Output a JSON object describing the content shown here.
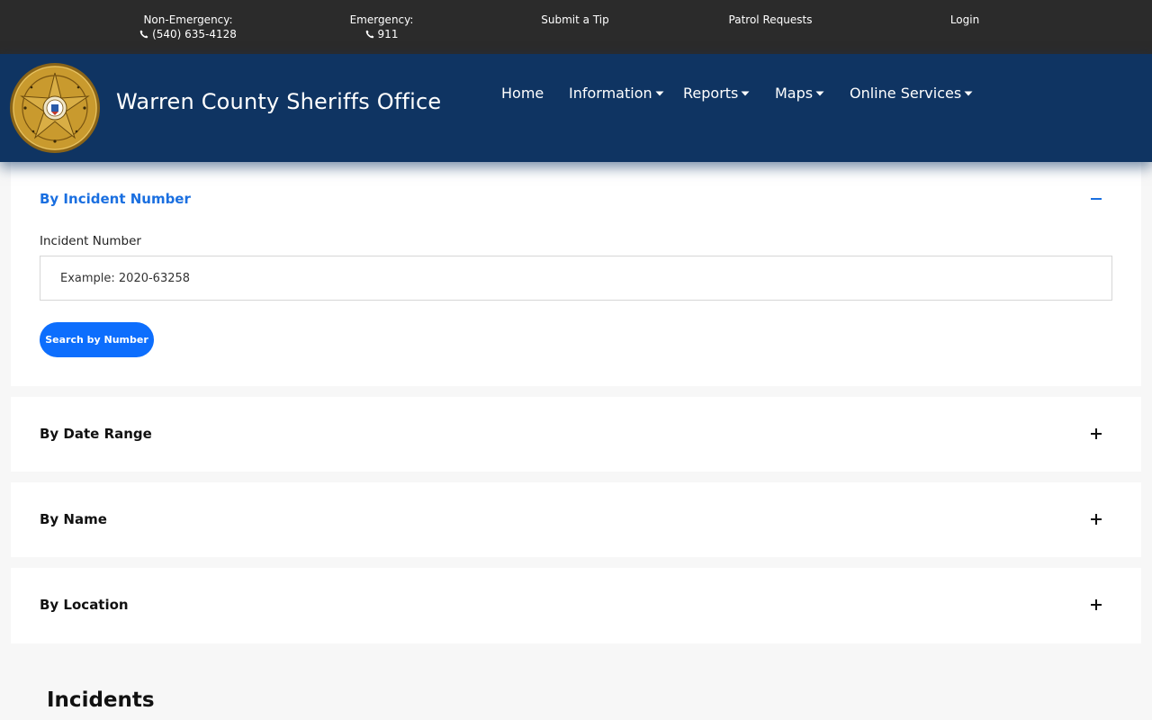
{
  "topbar": {
    "non_emergency_label": "Non-Emergency:",
    "non_emergency_phone": "(540) 635-4128",
    "emergency_label": "Emergency:",
    "emergency_phone": "911",
    "submit_tip": "Submit a Tip",
    "patrol_requests": "Patrol Requests",
    "login": "Login",
    "icons": {
      "phone": "phone-icon"
    }
  },
  "header": {
    "title": "Warren County Sheriffs Office",
    "logo_icon": "sheriff-star-badge",
    "nav": {
      "home": "Home",
      "information": "Information",
      "reports": "Reports",
      "maps": "Maps",
      "online_services": "Online Services"
    },
    "dropdown_icon": "caret-down-icon"
  },
  "search": {
    "incident": {
      "title": "By Incident Number",
      "expanded": true,
      "field_label": "Incident Number",
      "placeholder": "Example: 2020-63258",
      "value": "",
      "button_label": "Search by Number"
    },
    "date_range": {
      "title": "By Date Range",
      "expanded": false
    },
    "name": {
      "title": "By Name",
      "expanded": false
    },
    "location": {
      "title": "By Location",
      "expanded": false
    }
  },
  "incidents": {
    "heading": "Incidents"
  },
  "colors": {
    "topbar_bg": "#2b2b2b",
    "header_bg": "#0f3462",
    "accent_blue": "#0d6efd",
    "active_title": "#1a6fe0",
    "page_bg": "#f7f7f7",
    "badge_gold": "#c99a2e"
  }
}
